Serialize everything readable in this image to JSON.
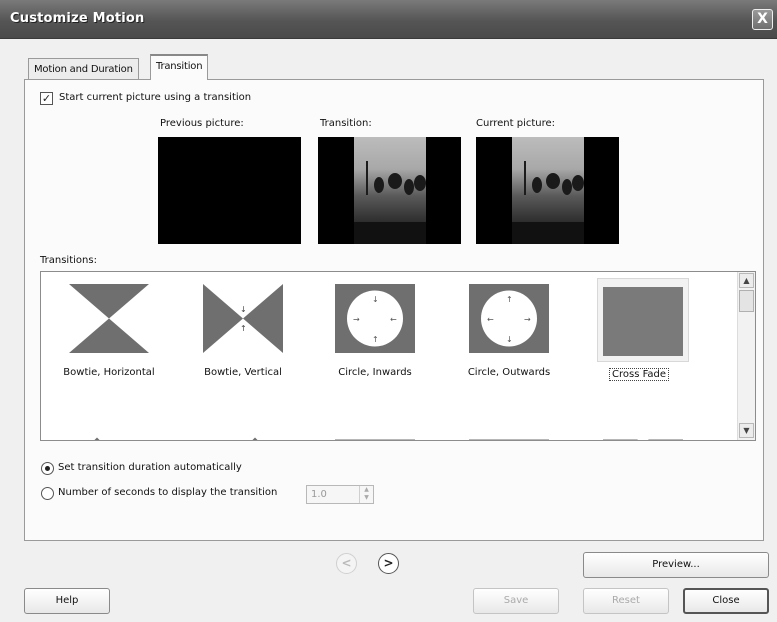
{
  "window": {
    "title": "Customize Motion",
    "close_symbol": "X"
  },
  "tabs": [
    {
      "label": "Motion and Duration",
      "active": false
    },
    {
      "label": "Transition",
      "active": true
    }
  ],
  "start_transition": {
    "label": "Start current picture using a transition",
    "checked": true
  },
  "previews": {
    "previous_label": "Previous picture:",
    "transition_label": "Transition:",
    "current_label": "Current picture:"
  },
  "transitions": {
    "label": "Transitions:",
    "items": [
      {
        "name": "Bowtie, Horizontal",
        "icon": "bowtie-horizontal-icon"
      },
      {
        "name": "Bowtie, Vertical",
        "icon": "bowtie-vertical-icon"
      },
      {
        "name": "Circle, Inwards",
        "icon": "circle-inwards-icon"
      },
      {
        "name": "Circle, Outwards",
        "icon": "circle-outwards-icon"
      },
      {
        "name": "Cross Fade",
        "icon": "cross-fade-icon",
        "selected": true
      }
    ]
  },
  "duration": {
    "auto_label": "Set transition duration automatically",
    "auto_selected": true,
    "seconds_label": "Number of seconds to display the transition",
    "seconds_value": "1.0"
  },
  "navigation": {
    "back_symbol": "<",
    "forward_symbol": ">"
  },
  "buttons": {
    "preview": "Preview...",
    "help": "Help",
    "save": "Save",
    "reset": "Reset",
    "close": "Close"
  },
  "colors": {
    "thumbnail_fill": "#6f6f6f",
    "selected_thumbnail_fill": "#7a7a7a"
  }
}
